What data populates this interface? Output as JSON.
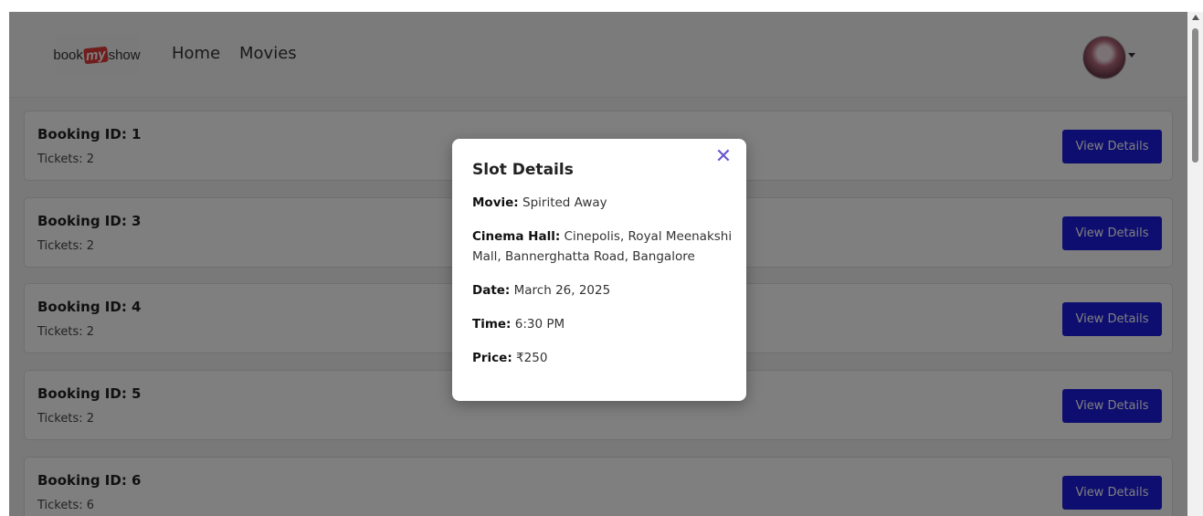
{
  "navbar": {
    "logo": {
      "part1": "book",
      "part2": "my",
      "part3": "show"
    },
    "links": [
      "Home",
      "Movies"
    ]
  },
  "bookings": [
    {
      "id_label": "Booking ID: 1",
      "tickets_label": "Tickets: 2",
      "button_label": "View Details"
    },
    {
      "id_label": "Booking ID: 3",
      "tickets_label": "Tickets: 2",
      "button_label": "View Details"
    },
    {
      "id_label": "Booking ID: 4",
      "tickets_label": "Tickets: 2",
      "button_label": "View Details"
    },
    {
      "id_label": "Booking ID: 5",
      "tickets_label": "Tickets: 2",
      "button_label": "View Details"
    },
    {
      "id_label": "Booking ID: 6",
      "tickets_label": "Tickets: 6",
      "button_label": "View Details"
    }
  ],
  "modal": {
    "title": "Slot Details",
    "close_symbol": "✕",
    "details": [
      {
        "label": "Movie:",
        "value": "Spirited Away"
      },
      {
        "label": "Cinema Hall:",
        "value": "Cinepolis, Royal Meenakshi Mall, Bannerghatta Road, Bangalore"
      },
      {
        "label": "Date:",
        "value": "March 26, 2025"
      },
      {
        "label": "Time:",
        "value": "6:30 PM"
      },
      {
        "label": "Price:",
        "value": "₹250"
      }
    ]
  },
  "colors": {
    "primary_button": "#1d1de0",
    "close_icon": "#6a5acd",
    "logo_accent": "#e23a3a"
  },
  "icons": {
    "close": "close-icon",
    "scroll_up": "chevron-up-icon"
  }
}
